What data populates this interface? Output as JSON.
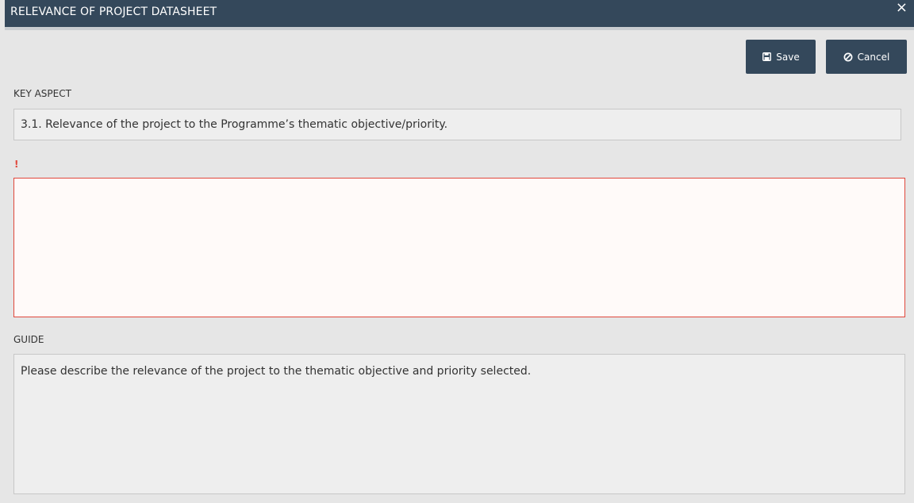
{
  "dialog": {
    "title": "RELEVANCE OF PROJECT DATASHEET",
    "close_label": "×"
  },
  "toolbar": {
    "save_label": "Save",
    "cancel_label": "Cancel",
    "save_icon": "floppy-disk-icon",
    "cancel_icon": "ban-circle-icon"
  },
  "key_aspect": {
    "label": "KEY ASPECT",
    "value": "3.1. Relevance of the project to the Programme’s thematic objective/priority."
  },
  "answer": {
    "required_marker": "!",
    "value": ""
  },
  "guide": {
    "label": "GUIDE",
    "text": "Please describe the relevance of the project to the thematic objective and priority selected."
  },
  "colors": {
    "header_bg": "#34485b",
    "background": "#e6e6e6",
    "error": "#e0473b"
  }
}
